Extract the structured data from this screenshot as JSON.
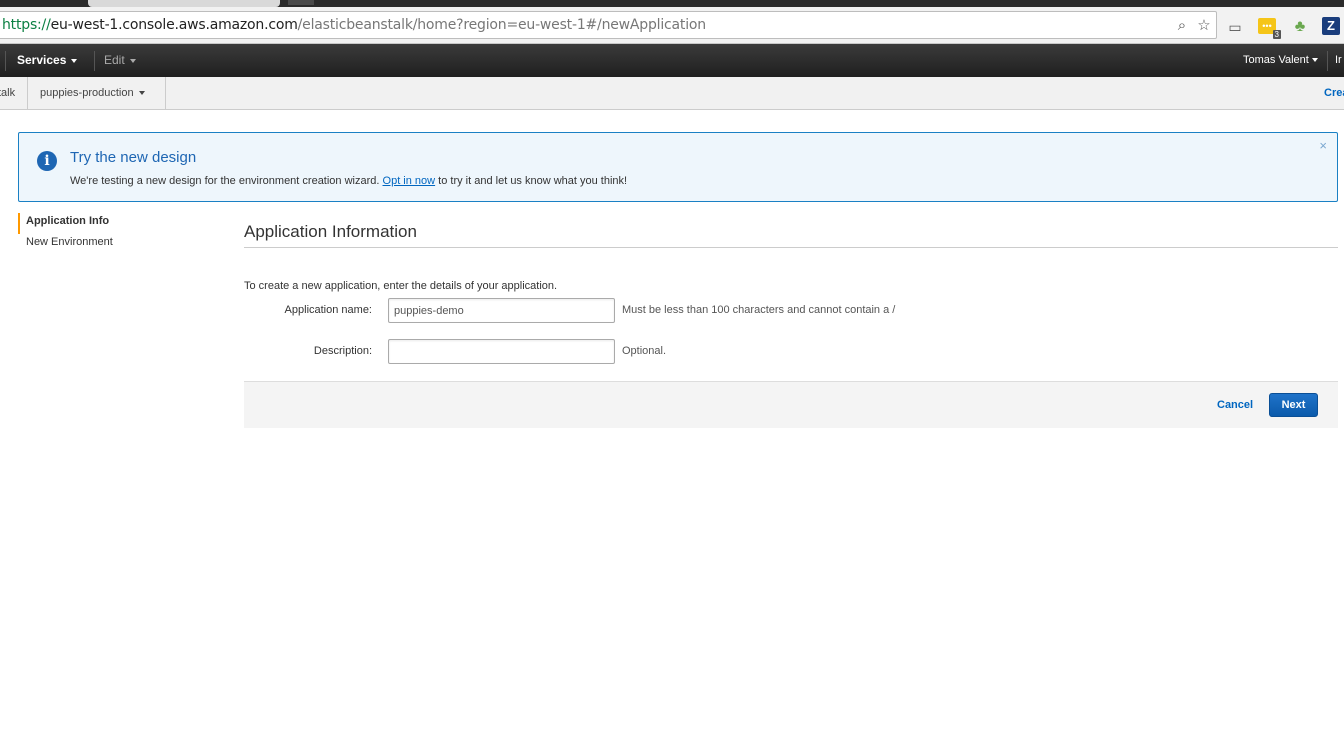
{
  "browser": {
    "url_scheme": "https://",
    "url_host": "eu-west-1.console.aws.amazon.com",
    "url_path": "/elasticbeanstalk/home?region=eu-west-1#/newApplication",
    "extension_badge_count": "3",
    "icons": [
      "zoom-icon",
      "star-icon",
      "cast-icon",
      "extension-badge-icon",
      "tree-extension-icon",
      "z-extension-icon"
    ]
  },
  "aws_nav": {
    "services": "Services",
    "edit": "Edit",
    "user": "Tomas Valent",
    "region": "Ir"
  },
  "service_bar": {
    "service": "talk",
    "application": "puppies-production",
    "create": "Crea"
  },
  "banner": {
    "title": "Try the new design",
    "msg_before": "We're testing a new design for the environment creation wizard.",
    "msg_link": "Opt in now",
    "msg_after": "to try it and let us know what you think!",
    "close": "×"
  },
  "wizard_steps": [
    {
      "label": "Application Info",
      "active": true
    },
    {
      "label": "New Environment",
      "active": false
    }
  ],
  "form": {
    "heading": "Application Information",
    "intro": "To create a new application, enter the details of your application.",
    "name_label": "Application name:",
    "name_value": "puppies-demo",
    "name_hint": "Must be less than 100 characters and cannot contain a /",
    "desc_label": "Description:",
    "desc_value": "",
    "desc_hint": "Optional.",
    "cancel": "Cancel",
    "next": "Next"
  },
  "colors": {
    "accent_blue": "#1e66b3",
    "link_blue": "#0066c0",
    "active_step": "#ff9900",
    "nav_bg": "#232f3e"
  }
}
